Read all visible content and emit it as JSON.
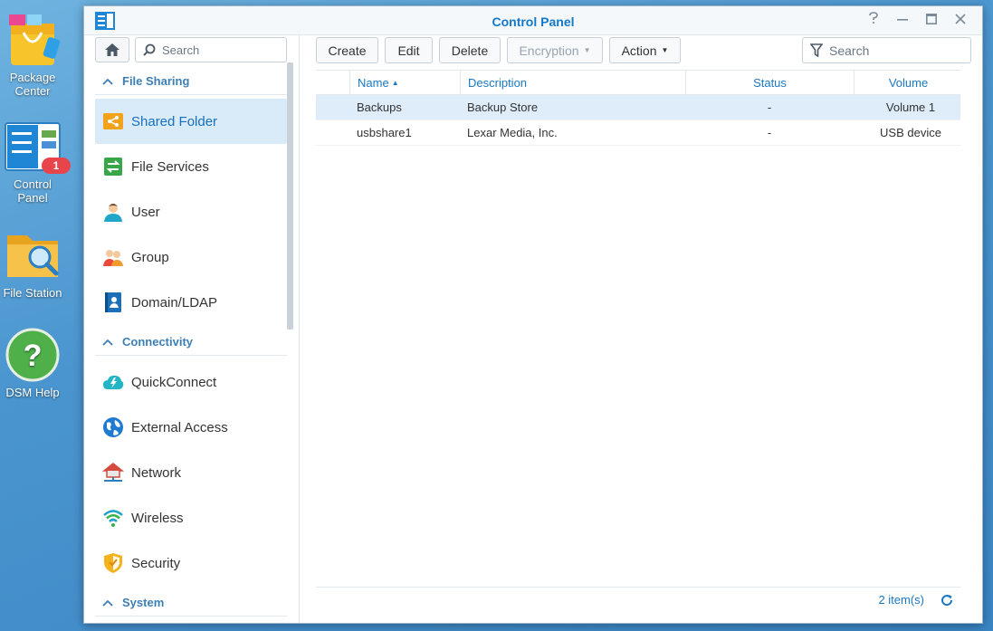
{
  "desktop": {
    "icons": [
      {
        "label_line1": "Package",
        "label_line2": "Center"
      },
      {
        "label": "Control Panel",
        "badge": "1"
      },
      {
        "label": "File Station"
      },
      {
        "label": "DSM Help"
      }
    ]
  },
  "window": {
    "title": "Control Panel",
    "controls": [
      "help",
      "minimize",
      "maximize",
      "close"
    ]
  },
  "sidebar": {
    "search_placeholder": "Search",
    "sections": [
      {
        "label": "File Sharing",
        "items": [
          {
            "label": "Shared Folder",
            "icon": "shared-folder-icon",
            "active": true
          },
          {
            "label": "File Services",
            "icon": "file-services-icon"
          },
          {
            "label": "User",
            "icon": "user-icon"
          },
          {
            "label": "Group",
            "icon": "group-icon"
          },
          {
            "label": "Domain/LDAP",
            "icon": "domain-ldap-icon"
          }
        ]
      },
      {
        "label": "Connectivity",
        "items": [
          {
            "label": "QuickConnect",
            "icon": "quickconnect-icon"
          },
          {
            "label": "External Access",
            "icon": "globe-icon"
          },
          {
            "label": "Network",
            "icon": "network-icon"
          },
          {
            "label": "Wireless",
            "icon": "wifi-icon"
          },
          {
            "label": "Security",
            "icon": "shield-icon"
          }
        ]
      },
      {
        "label": "System",
        "items": []
      }
    ]
  },
  "toolbar": {
    "create": "Create",
    "edit": "Edit",
    "delete": "Delete",
    "encryption": "Encryption",
    "action": "Action",
    "search_placeholder": "Search"
  },
  "grid": {
    "columns": [
      "Name",
      "Description",
      "Status",
      "Volume"
    ],
    "rows": [
      {
        "name": "Backups",
        "description": "Backup Store",
        "status": "-",
        "volume": "Volume 1",
        "selected": true
      },
      {
        "name": "usbshare1",
        "description": "Lexar Media, Inc.",
        "status": "-",
        "volume": "USB device",
        "selected": false
      }
    ]
  },
  "footer": {
    "count": "2 item(s)"
  },
  "colors": {
    "accent": "#1a78c2",
    "selected_row": "#deedf9",
    "active_sidebar": "#d9ebf9"
  }
}
